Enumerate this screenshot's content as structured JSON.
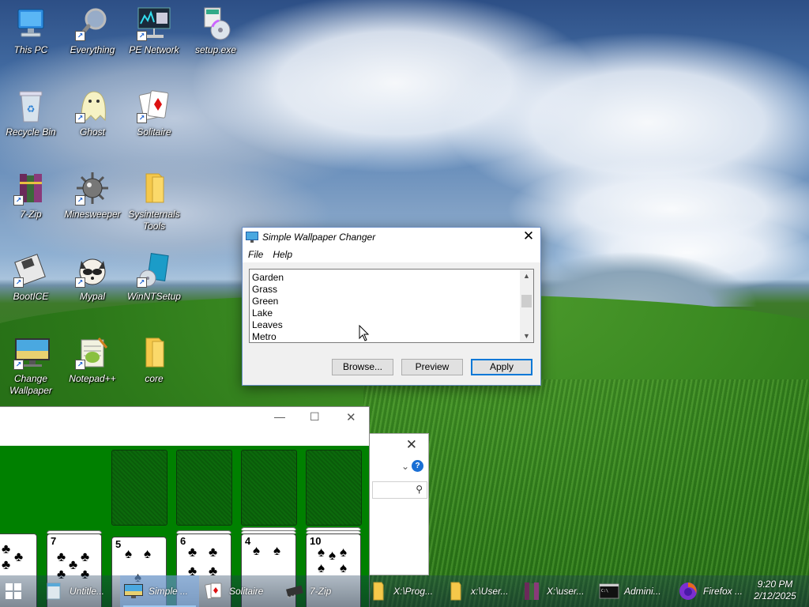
{
  "desktop": {
    "icons": [
      {
        "label": "This PC",
        "icon": "computer-icon"
      },
      {
        "label": "Everything",
        "icon": "magnifier-icon"
      },
      {
        "label": "PE Network",
        "icon": "network-icon"
      },
      {
        "label": "setup.exe",
        "icon": "installer-disc-icon"
      },
      {
        "label": "Recycle Bin",
        "icon": "recycle-bin-icon"
      },
      {
        "label": "Ghost",
        "icon": "ghost-icon"
      },
      {
        "label": "Solitaire",
        "icon": "playing-card-icon"
      },
      {
        "label": "7-Zip",
        "icon": "archive-books-icon"
      },
      {
        "label": "Minesweeper",
        "icon": "mine-icon"
      },
      {
        "label": "Sysinternals Tools",
        "icon": "folder-icon"
      },
      {
        "label": "BootICE",
        "icon": "floppy-icon"
      },
      {
        "label": "Mypal",
        "icon": "raccoon-icon"
      },
      {
        "label": "WinNTSetup",
        "icon": "windows-disc-icon"
      },
      {
        "label": "Change Wallpaper",
        "icon": "monitor-landscape-icon"
      },
      {
        "label": "Notepad++",
        "icon": "notepad-plus-icon"
      },
      {
        "label": "core",
        "icon": "folder-icon"
      }
    ]
  },
  "dialog": {
    "title": "Simple Wallpaper Changer",
    "close_glyph": "✕",
    "menu": {
      "file": "File",
      "help": "Help"
    },
    "list_items": [
      "Garden",
      "Grass",
      "Green",
      "Lake",
      "Leaves",
      "Metro"
    ],
    "scroll_up_glyph": "▲",
    "scroll_down_glyph": "▼",
    "buttons": {
      "browse": "Browse...",
      "preview": "Preview",
      "apply": "Apply"
    }
  },
  "explorer": {
    "close_glyph": "✕",
    "chevron_glyph": "⌄",
    "help_glyph": "?",
    "search_glyph": "⚲"
  },
  "solitaire": {
    "minimize_glyph": "—",
    "maximize_glyph": "☐",
    "close_glyph": "✕",
    "tableau_ranks": [
      "",
      "7",
      "5",
      "6",
      "4",
      "10"
    ],
    "suit_glyph": "♣",
    "spade_glyph": "♠"
  },
  "taskbar": {
    "items": [
      {
        "label": "",
        "icon": "start-icon"
      },
      {
        "label": "Untitle...",
        "icon": "notepad-icon"
      },
      {
        "label": "Simple ...",
        "icon": "wallpaper-changer-icon",
        "active": true
      },
      {
        "label": "Solitaire",
        "icon": "playing-card-icon"
      },
      {
        "label": "7-Zip",
        "icon": "chip-icon"
      },
      {
        "label": "X:\\Prog...",
        "icon": "folder-icon"
      },
      {
        "label": "x:\\User...",
        "icon": "folder-icon"
      },
      {
        "label": "X:\\user...",
        "icon": "archive-books-icon"
      },
      {
        "label": "Admini...",
        "icon": "cmd-icon"
      },
      {
        "label": "Firefox ...",
        "icon": "firefox-icon"
      }
    ],
    "time": "9:20 PM",
    "date": "2/12/2025"
  },
  "colors": {
    "accent": "#0078d7",
    "felt": "#008000",
    "taskbar_active": "#78aae6"
  }
}
